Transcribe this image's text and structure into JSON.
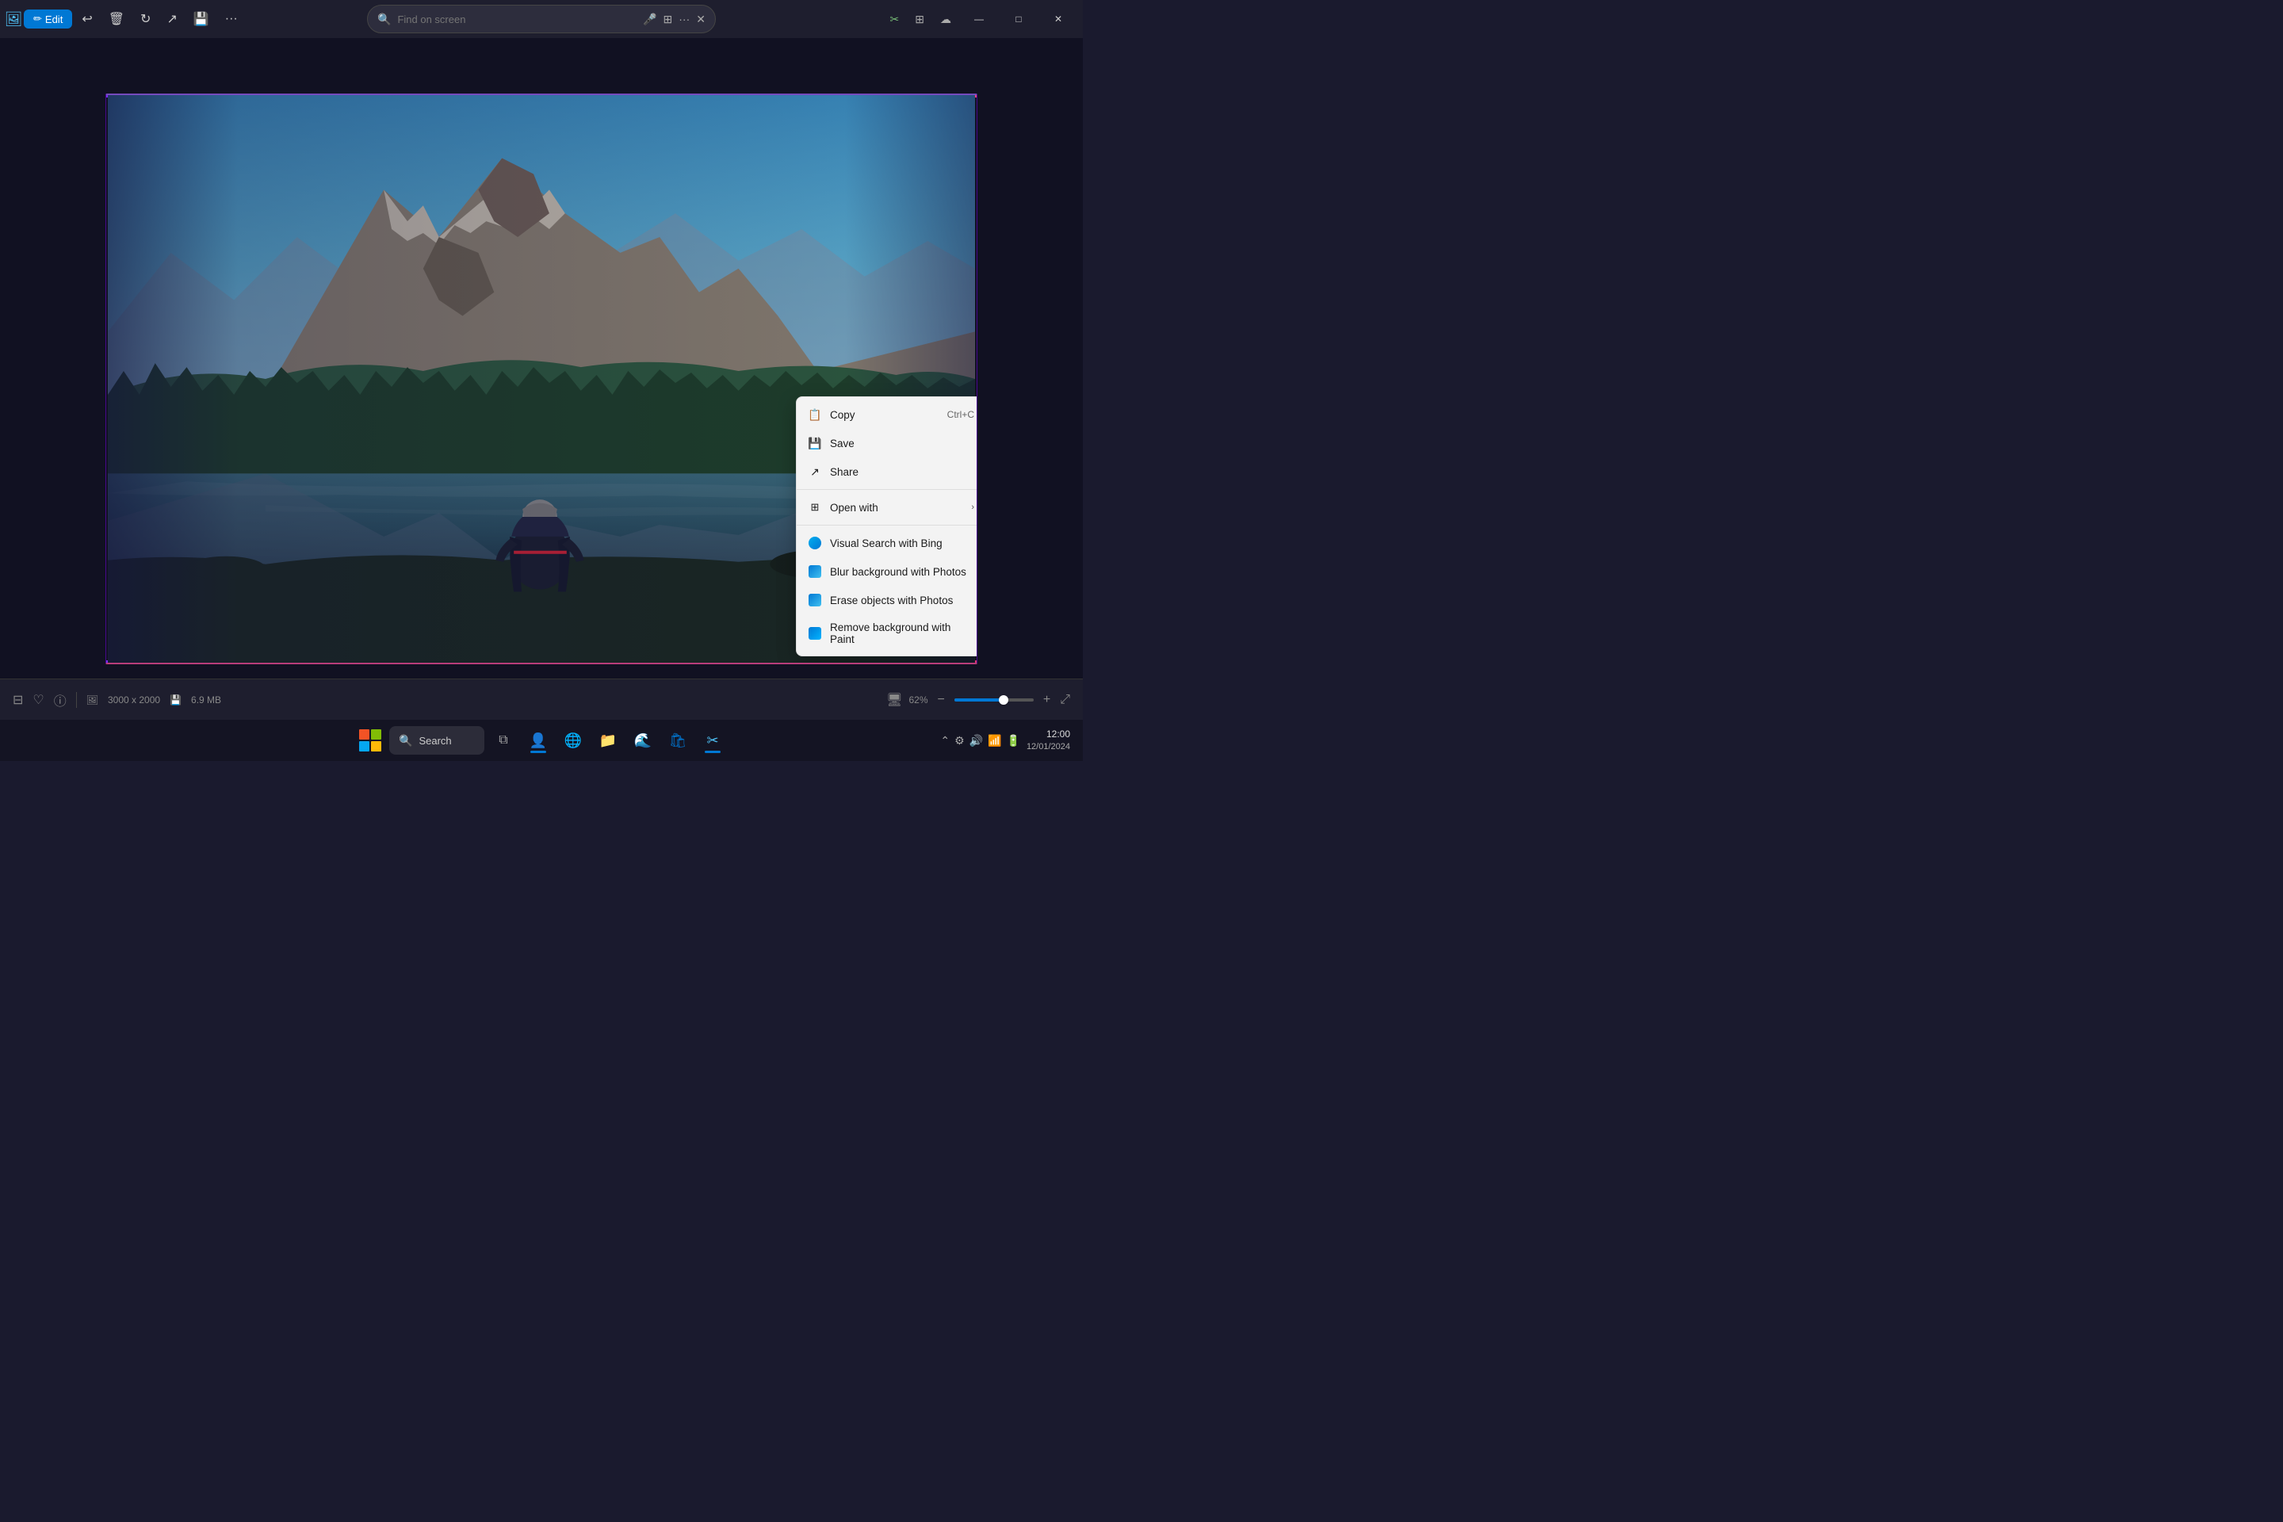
{
  "titlebar": {
    "edit_label": "Edit",
    "search_placeholder": "Find on screen",
    "more_options_label": "...",
    "minimize_label": "—",
    "maximize_label": "□",
    "close_label": "✕"
  },
  "toolbar": {
    "undo_icon": "↩",
    "delete_icon": "🗑",
    "rotate_icon": "↻",
    "share_icon": "⬡",
    "more_icon": "···"
  },
  "context_menu": {
    "items": [
      {
        "id": "copy",
        "label": "Copy",
        "shortcut": "Ctrl+C",
        "icon": "📋"
      },
      {
        "id": "save",
        "label": "Save",
        "shortcut": "",
        "icon": "💾"
      },
      {
        "id": "share",
        "label": "Share",
        "shortcut": "",
        "icon": "↗"
      },
      {
        "id": "open-with",
        "label": "Open with",
        "shortcut": "",
        "icon": "⊞",
        "has_arrow": true
      },
      {
        "id": "visual-search",
        "label": "Visual Search with Bing",
        "shortcut": "",
        "icon": "bing"
      },
      {
        "id": "blur-bg",
        "label": "Blur background with Photos",
        "shortcut": "",
        "icon": "photos"
      },
      {
        "id": "erase-objects",
        "label": "Erase objects with Photos",
        "shortcut": "",
        "icon": "photos"
      },
      {
        "id": "remove-bg",
        "label": "Remove background with Paint",
        "shortcut": "",
        "icon": "paint"
      }
    ]
  },
  "status_bar": {
    "dimensions": "3000 x 2000",
    "file_size": "6.9 MB",
    "zoom_percent": "62%"
  },
  "taskbar": {
    "search_label": "Search",
    "time": "12:00",
    "date": "12/01/2024"
  }
}
